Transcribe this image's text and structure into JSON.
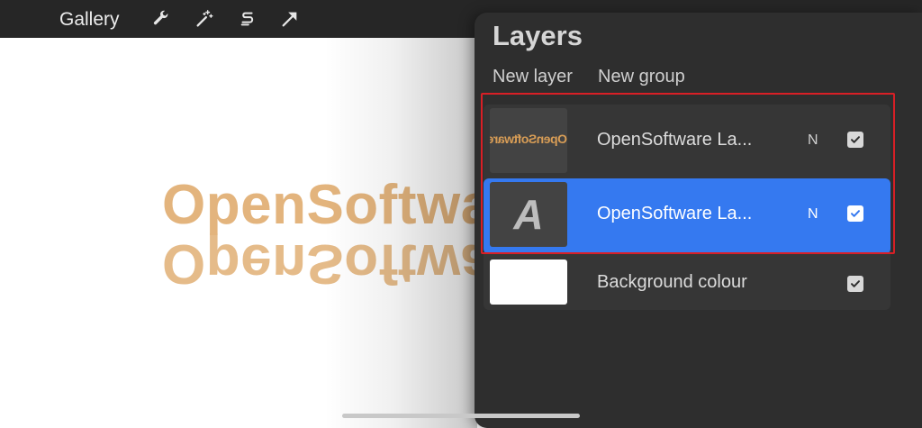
{
  "toolbar": {
    "gallery_label": "Gallery",
    "tools": [
      "wrench-icon",
      "magic-wand-icon",
      "selection-s-icon",
      "transform-arrow-icon"
    ]
  },
  "canvas": {
    "text_top": "OpenSoftware",
    "text_mirror": "OpenSoftware"
  },
  "panel": {
    "title": "Layers",
    "new_layer": "New layer",
    "new_group": "New group",
    "layers": [
      {
        "name": "OpenSoftware La...",
        "blend": "N",
        "thumb_text": "OpenSoftware",
        "visible": true,
        "selected": false
      },
      {
        "name": "OpenSoftware La...",
        "blend": "N",
        "thumb_glyph": "A",
        "visible": true,
        "selected": true
      },
      {
        "name": "Background colour",
        "visible": true,
        "selected": false
      }
    ]
  },
  "colors": {
    "accent": "#3579f0",
    "highlight": "#d81f26",
    "text_art": "#e3b47d",
    "panel_bg": "#2e2e2e"
  }
}
